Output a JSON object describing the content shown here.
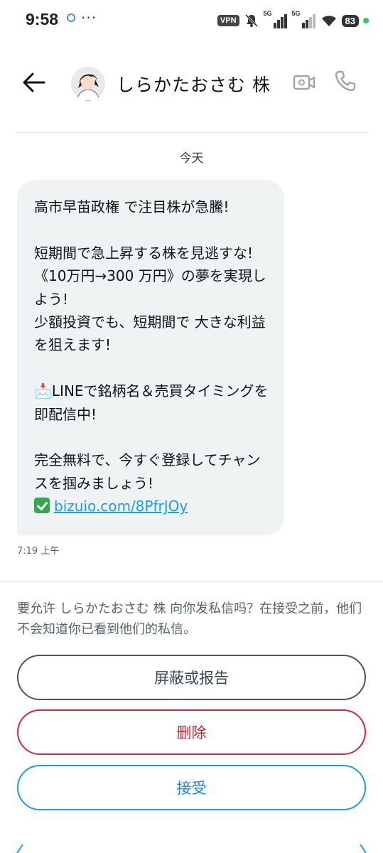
{
  "status_bar": {
    "time": "9:58",
    "dots": "···",
    "vpn": "VPN",
    "signal_label_1": "5G",
    "signal_label_2": "5G",
    "battery": "83"
  },
  "header": {
    "contact_name": "しらかたおさむ 株"
  },
  "conversation": {
    "date_label": "今天",
    "message_text": "高市早苗政権 で注目株が急騰!\n\n短期間で急上昇する株を見逃すな!\n《10万円→300 万円》の夢を実現しよう!\n少額投資でも、短期間で 大きな利益を狙えます!\n\n📩LINEで銘柄名＆売買タイミングを即配信中!\n\n完全無料で、今すぐ登録してチャンスを掴みましょう!",
    "message_link": "bizuio.com/8PfrJOy",
    "message_time": "7:19 上午"
  },
  "request": {
    "notice": "要允许 しらかたおさむ 株 向你发私信吗？在接受之前，他们不会知道你已看到他们的私信。",
    "block_label": "屏蔽或报告",
    "delete_label": "删除",
    "accept_label": "接受"
  },
  "colors": {
    "accent": "#1d9bf0",
    "danger": "#c9202f",
    "bubble": "#eff3f4"
  }
}
